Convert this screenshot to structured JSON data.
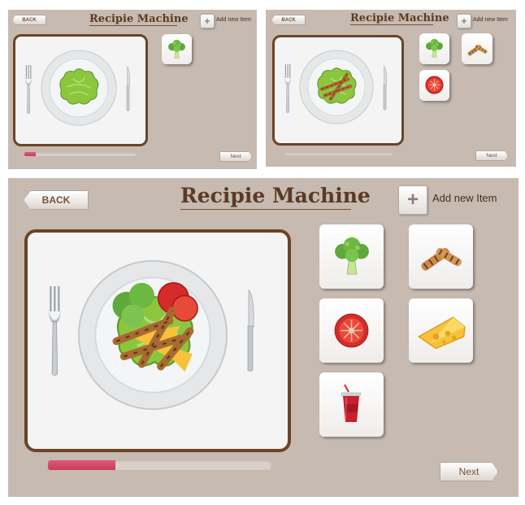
{
  "screens": [
    {
      "back": "BACK",
      "title": "Recipie Machine",
      "add_label": "Add new Item",
      "add_symbol": "+",
      "next": "Next",
      "progress": 0.1,
      "tiles": [
        "broccoli-icon"
      ]
    },
    {
      "back": "BACK",
      "title": "Recipie Machine",
      "add_label": "Add new Item",
      "add_symbol": "+",
      "next": "Next",
      "progress": 0.0,
      "tiles": [
        "broccoli-icon",
        "chicken-icon",
        "tomato-icon"
      ]
    },
    {
      "back": "BACK",
      "title": "Recipie Machine",
      "add_label": "Add new Item",
      "add_symbol": "+",
      "next": "Next",
      "progress": 0.3,
      "tiles": [
        "broccoli-icon",
        "chicken-icon",
        "tomato-icon",
        "cheese-icon",
        "soda-cup-icon"
      ]
    }
  ],
  "colors": {
    "background": "#c6bab1",
    "frame": "#6b4427",
    "title": "#5b3a24",
    "progress": "#d64a69"
  }
}
